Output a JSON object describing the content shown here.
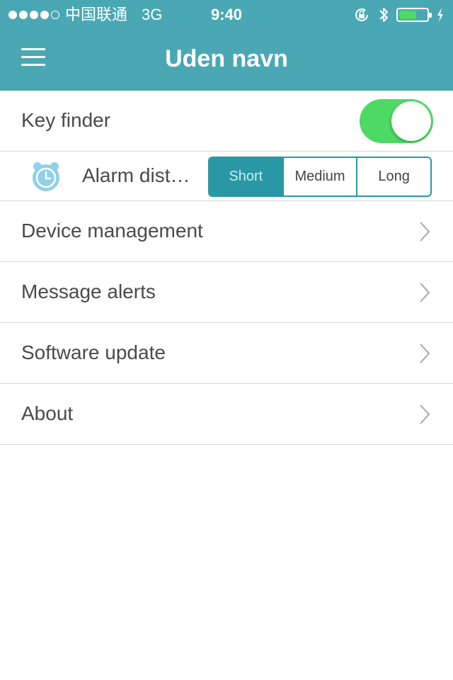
{
  "status_bar": {
    "signal_filled": 4,
    "signal_total": 5,
    "carrier": "中国联通",
    "network": "3G",
    "time": "9:40",
    "icons": [
      "rotation-lock-icon",
      "bluetooth-icon",
      "battery-icon",
      "charging-icon"
    ],
    "battery_level": 0.62
  },
  "nav": {
    "title": "Uden navn",
    "menu_icon": "hamburger-menu-icon"
  },
  "settings": {
    "key_finder": {
      "label": "Key finder",
      "enabled": true
    },
    "alarm_distance": {
      "label": "Alarm dist…",
      "icon": "alarm-clock-icon",
      "options": [
        "Short",
        "Medium",
        "Long"
      ],
      "selected": "Short"
    },
    "menu_items": [
      {
        "label": "Device management",
        "icon": "chevron-right-icon"
      },
      {
        "label": "Message alerts",
        "icon": "chevron-right-icon"
      },
      {
        "label": "Software update",
        "icon": "chevron-right-icon"
      },
      {
        "label": "About",
        "icon": "chevron-right-icon"
      }
    ]
  },
  "colors": {
    "header": "#4aa8b4",
    "accent": "#2a97a4",
    "toggle_on": "#4cd964",
    "alarm_icon": "#8fd0ea"
  }
}
